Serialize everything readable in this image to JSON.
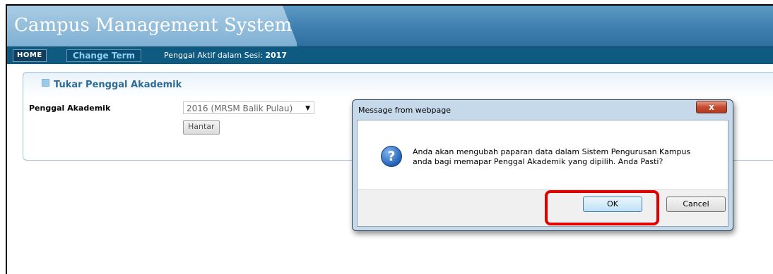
{
  "header": {
    "title": "Campus Management System"
  },
  "nav": {
    "home": "HOME",
    "change_term": "Change Term",
    "session_label": "Penggal Aktif dalam Sesi:",
    "session_value": "2017"
  },
  "panel": {
    "heading": "Tukar Penggal Akademik",
    "field_label": "Penggal Akademik",
    "select_value": "2016 (MRSM Balik Pulau)",
    "submit_label": "Hantar"
  },
  "dialog": {
    "title": "Message from webpage",
    "close_symbol": "x",
    "icon_symbol": "?",
    "message_line1": "Anda akan mengubah paparan data dalam Sistem Pengurusan Kampus",
    "message_line2": "anda bagi memapar Penggal Akademik yang dipilih. Anda Pasti?",
    "ok_label": "OK",
    "cancel_label": "Cancel"
  },
  "colors": {
    "highlight": "#e00000",
    "nav_bg": "#0e5a80",
    "accent": "#2d6b99"
  },
  "icons": {
    "dialog_icon": "question-icon",
    "panel_icon": "arrow-icon",
    "close_icon": "close-icon",
    "select_icon": "chevron-down-icon"
  }
}
